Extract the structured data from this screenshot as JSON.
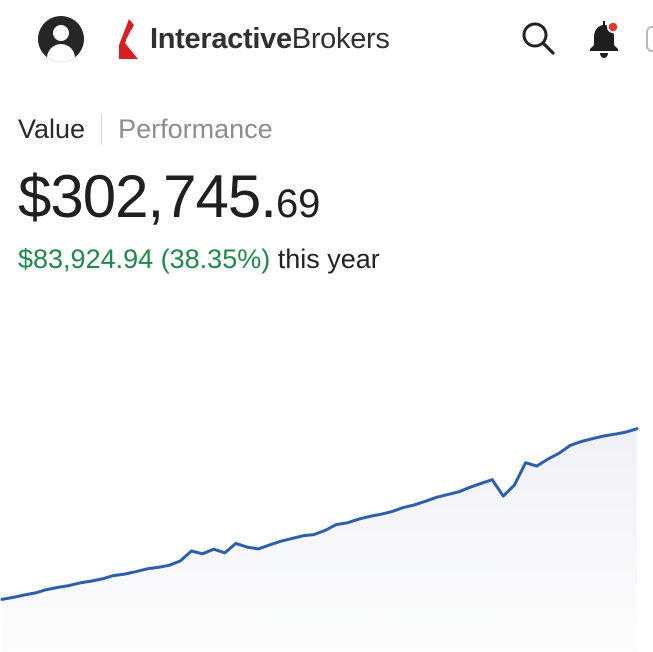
{
  "header": {
    "logo": {
      "bold": "Interactive",
      "light": "Brokers",
      "brand_color": "#d71f26"
    },
    "icons": [
      "user-avatar-icon",
      "search-icon",
      "bell-icon"
    ],
    "notification_dot_color": "#e23a2f"
  },
  "tabs": [
    {
      "label": "Value",
      "active": true
    },
    {
      "label": "Performance",
      "active": false
    }
  ],
  "balance": {
    "main": "$302,745.",
    "cents": "69"
  },
  "change": {
    "amount": "$83,924.94",
    "percent": "(38.35%)",
    "period": "this year",
    "color": "#1e8a4a"
  },
  "chart_data": {
    "type": "line",
    "y": [
      218840.75,
      219500,
      220300,
      221000,
      222100,
      222800,
      223400,
      224300,
      224900,
      225600,
      226700,
      227200,
      228000,
      228900,
      229400,
      230100,
      231500,
      234800,
      233900,
      235400,
      234200,
      237300,
      236100,
      235500,
      236800,
      238000,
      238900,
      239800,
      240200,
      241600,
      243500,
      244100,
      245300,
      246200,
      246900,
      247800,
      249100,
      250000,
      251200,
      252500,
      253400,
      254300,
      255800,
      257100,
      258300,
      252900,
      256600,
      263900,
      262800,
      265100,
      267000,
      269600,
      270900,
      271800,
      272700,
      273300,
      274000,
      275100
    ],
    "line_color": "#2a5fb0",
    "fill_color": "#eef0f6"
  }
}
